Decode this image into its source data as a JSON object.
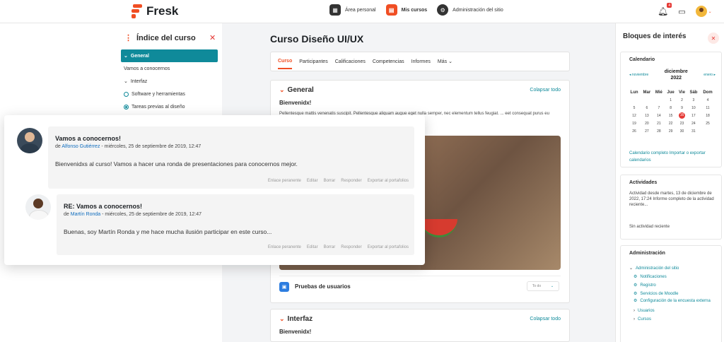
{
  "brand": {
    "name": "Fresk",
    "color": "#f04e23"
  },
  "nav": {
    "items": [
      {
        "label": "Área personal",
        "icon": "dashboard-icon"
      },
      {
        "label": "Mis cursos",
        "icon": "courses-icon",
        "active": true
      },
      {
        "label": "Administración del sitio",
        "icon": "admin-icon"
      }
    ],
    "notifications_count": "4"
  },
  "course_index": {
    "title": "Índice del curso",
    "items": [
      {
        "label": "General",
        "active": true
      },
      {
        "label": "Vamos a conocernos"
      },
      {
        "label": "Interfaz"
      },
      {
        "label": "Software y herramientas"
      },
      {
        "label": "Tareas previas al diseño"
      }
    ]
  },
  "course": {
    "title": "Curso Diseño UI/UX",
    "tabs": [
      "Curso",
      "Participantes",
      "Calificaciones",
      "Competencias",
      "Informes",
      "Más"
    ],
    "section1": {
      "title": "General",
      "collapse": "Colapsar todo",
      "subtitle": "Bienvenidx!",
      "text": "Pellentesque mattis venenatis suscipit. Pellentesque aliquam augue eget nulla semper, nec elementum tellus feugiat. ... eet consequat purus eu mattis. Nunc dictum condimentum",
      "resource": "Pruebas de usuarios",
      "todo": "To do"
    },
    "section2": {
      "title": "Interfaz",
      "collapse": "Colapsar todo",
      "subtitle": "Bienvenidx!"
    }
  },
  "blocks": {
    "title": "Bloques de interés",
    "calendar": {
      "title": "Calendario",
      "prev": "◂ noviembre",
      "month": "diciembre",
      "year": "2022",
      "next": "enero ▸",
      "days": [
        "Lun",
        "Mar",
        "Mié",
        "Jue",
        "Vie",
        "Sáb",
        "Dom"
      ],
      "weeks": [
        [
          "",
          "",
          "",
          "1",
          "2",
          "3",
          "4"
        ],
        [
          "5",
          "6",
          "7",
          "8",
          "9",
          "10",
          "11"
        ],
        [
          "12",
          "13",
          "14",
          "15",
          "16",
          "17",
          "18"
        ],
        [
          "19",
          "20",
          "21",
          "22",
          "23",
          "24",
          "25"
        ],
        [
          "26",
          "27",
          "28",
          "29",
          "30",
          "31",
          ""
        ]
      ],
      "today": "16",
      "link_full": "Calendario completo",
      "link_export": "Importar o exportar calendarios"
    },
    "activities": {
      "title": "Actividades",
      "text": "Actividad desde martes, 13 de diciembre de 2022, 17:24 Informe completo de la actividad reciente...",
      "none": "Sin actividad reciente"
    },
    "admin": {
      "title": "Administración",
      "root": "Administración del sitio",
      "items": [
        "Notificaciones",
        "Registro",
        "Servicios de Moodle",
        "Configuración de la encuesta externa"
      ],
      "sub": [
        "Usuarios",
        "Cursos"
      ]
    }
  },
  "forum": {
    "post1": {
      "subject": "Vamos a conocernos!",
      "by": "de",
      "author": "Alfonso Gutiérrez",
      "date": "- miércoles, 25 de septiembre de 2019, 12:47",
      "body": "Bienvenidxs al curso! Vamos a hacer una ronda de presentaciones para conocernos mejor."
    },
    "post2": {
      "subject": "RE: Vamos a conocernos!",
      "by": "de",
      "author": "Martín Ronda",
      "date": "- miércoles, 25 de septiembre de 2019, 12:47",
      "body": "Buenas, soy Martín Ronda y me hace mucha ilusión participar en este curso..."
    },
    "actions": [
      "Enlace peranente",
      "Editar",
      "Borrar",
      "Responder",
      "Exportar al portafolios"
    ]
  }
}
